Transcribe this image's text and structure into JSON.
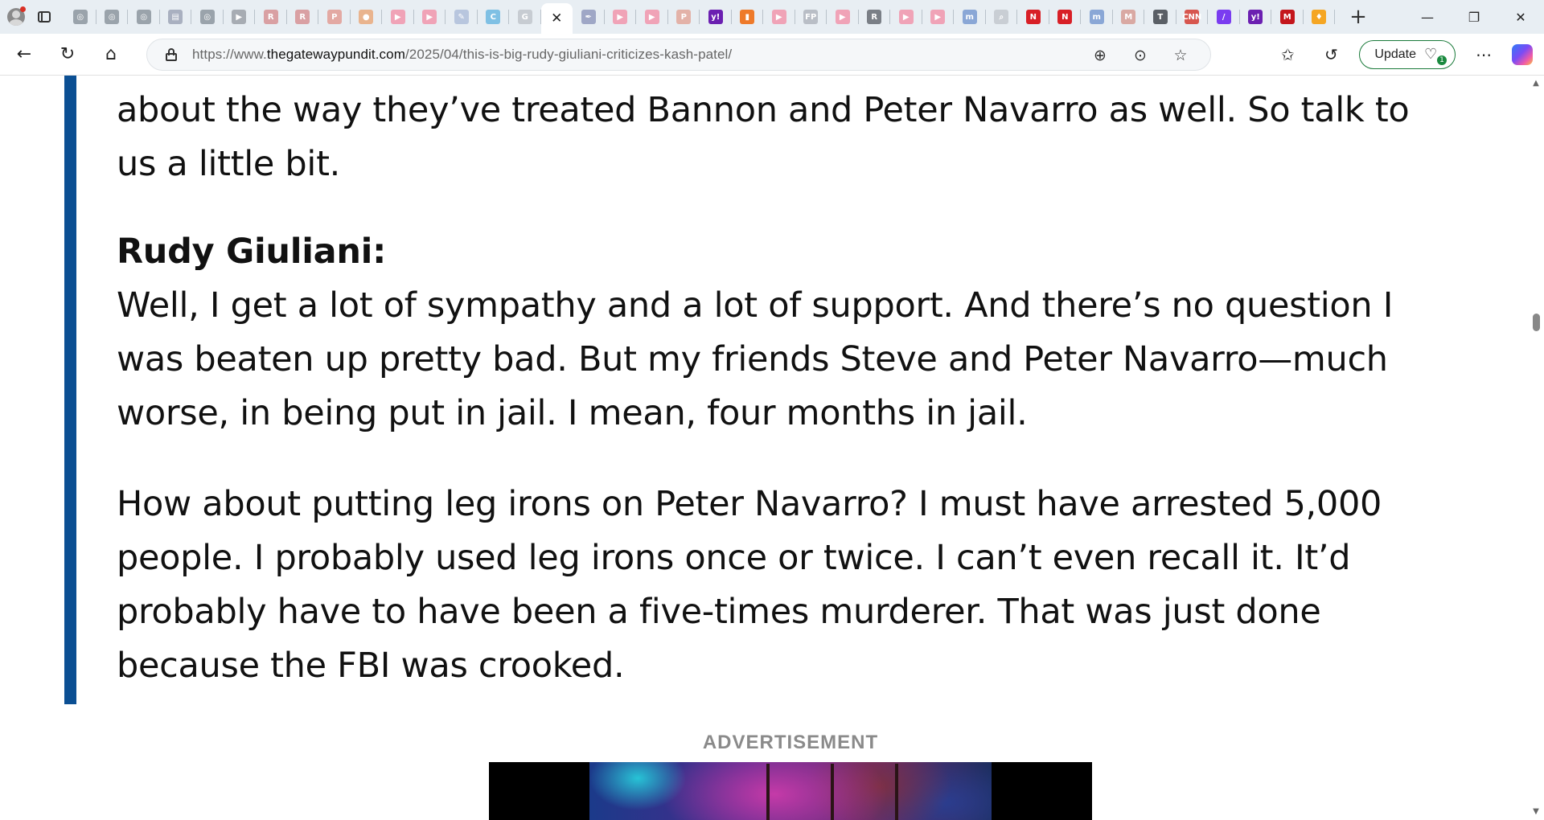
{
  "browser": {
    "tabs": [
      {
        "icon": "globe-icon",
        "color": "#9aa3ab",
        "glyph": "◎"
      },
      {
        "icon": "globe-icon",
        "color": "#9aa3ab",
        "glyph": "◎"
      },
      {
        "icon": "globe-icon",
        "color": "#9aa3ab",
        "glyph": "◎"
      },
      {
        "icon": "news-icon",
        "color": "#a9b0c0",
        "glyph": "▤"
      },
      {
        "icon": "globe-icon",
        "color": "#9aa3ab",
        "glyph": "◎"
      },
      {
        "icon": "arrow-icon",
        "color": "#a7acb3",
        "glyph": "▶"
      },
      {
        "icon": "r-icon",
        "color": "#d9a0a3",
        "glyph": "R"
      },
      {
        "icon": "r-icon",
        "color": "#d9a0a3",
        "glyph": "R"
      },
      {
        "icon": "pdf-icon",
        "color": "#e3a9a3",
        "glyph": "P"
      },
      {
        "icon": "circle-icon",
        "color": "#e9b48e",
        "glyph": "●"
      },
      {
        "icon": "youtube-icon",
        "color": "#f0a3b7",
        "glyph": "▶"
      },
      {
        "icon": "youtube-icon",
        "color": "#f0a3b7",
        "glyph": "▶"
      },
      {
        "icon": "feather-icon",
        "color": "#b8c6de",
        "glyph": "✎"
      },
      {
        "icon": "c-icon",
        "color": "#7fc0e4",
        "glyph": "C"
      },
      {
        "icon": "google-icon",
        "color": "#c7ccd2",
        "glyph": "G"
      },
      {
        "icon": "close-icon",
        "color": "#ffffff",
        "glyph": "✕",
        "active": true
      },
      {
        "icon": "pen-icon",
        "color": "#9fa7c6",
        "glyph": "✒"
      },
      {
        "icon": "youtube-icon",
        "color": "#f0a3b7",
        "glyph": "▶"
      },
      {
        "icon": "youtube-icon",
        "color": "#f0a3b7",
        "glyph": "▶"
      },
      {
        "icon": "pdf-icon",
        "color": "#e3b2a8",
        "glyph": "P"
      },
      {
        "icon": "yahoo-icon",
        "color": "#6b1fb1",
        "glyph": "y!"
      },
      {
        "icon": "bookmark-icon",
        "color": "#ee7a2a",
        "glyph": "▮"
      },
      {
        "icon": "youtube-icon",
        "color": "#f0a3b7",
        "glyph": "▶"
      },
      {
        "icon": "fp-icon",
        "color": "#b9bec6",
        "glyph": "FP"
      },
      {
        "icon": "youtube-icon",
        "color": "#f0a3b7",
        "glyph": "▶"
      },
      {
        "icon": "r-icon",
        "color": "#7a7f86",
        "glyph": "R"
      },
      {
        "icon": "youtube-icon",
        "color": "#f0a3b7",
        "glyph": "▶"
      },
      {
        "icon": "youtube-icon",
        "color": "#f0a3b7",
        "glyph": "▶"
      },
      {
        "icon": "m-icon",
        "color": "#8aa7d6",
        "glyph": "m"
      },
      {
        "icon": "search-icon",
        "color": "#c9ced4",
        "glyph": "⌕"
      },
      {
        "icon": "n-icon",
        "color": "#d81f26",
        "glyph": "N"
      },
      {
        "icon": "n-icon",
        "color": "#d81f26",
        "glyph": "N"
      },
      {
        "icon": "m-icon",
        "color": "#8aa7d6",
        "glyph": "m"
      },
      {
        "icon": "m-icon",
        "color": "#d9a9a3",
        "glyph": "M"
      },
      {
        "icon": "nyt-icon",
        "color": "#5a5f66",
        "glyph": "T"
      },
      {
        "icon": "cnn-icon",
        "color": "#d7564e",
        "glyph": "CNN"
      },
      {
        "icon": "slash-icon",
        "color": "#7a3cf0",
        "glyph": "/"
      },
      {
        "icon": "yahoo-icon",
        "color": "#6b1fb1",
        "glyph": "y!"
      },
      {
        "icon": "m-icon",
        "color": "#c4161c",
        "glyph": "M"
      },
      {
        "icon": "flame-icon",
        "color": "#f5a623",
        "glyph": "♦"
      }
    ],
    "window_controls": {
      "minimize": "—",
      "restore": "❐",
      "close": "✕"
    },
    "url_prefix": "https://www.",
    "url_domain": "thegatewaypundit.com",
    "url_path": "/2025/04/this-is-big-rudy-giuliani-criticizes-kash-patel/",
    "update_label": "Update",
    "update_badge": "1"
  },
  "article": {
    "intro_lines": [
      "about the way they’ve treated Bannon and Peter Navarro as well. So talk to",
      "us a little bit."
    ],
    "speaker": "Rudy Giuliani:",
    "para1_lines": [
      "Well, I get a lot of sympathy and a lot of support. And there’s no question I",
      "was beaten up pretty bad. But my friends Steve and Peter Navarro—much",
      "worse, in being put in jail. I mean, four months in jail."
    ],
    "para2_lines": [
      "How about putting leg irons on Peter Navarro? I must have arrested 5,000",
      "people. I probably used leg irons once or twice. I can’t even recall it. It’d",
      "probably have to have been a five-times murderer. That was just done",
      "because the FBI was crooked."
    ],
    "ad_label": "ADVERTISEMENT"
  },
  "colors": {
    "quote_bar": "#0b4f93",
    "update_border": "#1a7a3a"
  }
}
